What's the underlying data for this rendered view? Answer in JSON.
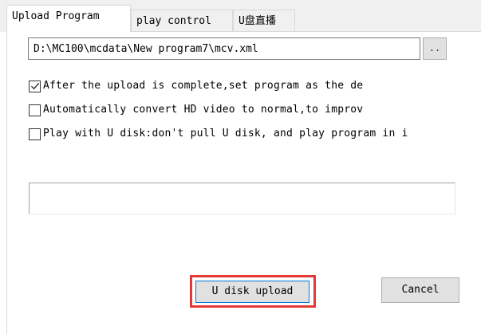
{
  "tabs": [
    {
      "label": "Upload Program",
      "active": true
    },
    {
      "label": "play control",
      "active": false
    },
    {
      "label": "U盘直播",
      "active": false
    }
  ],
  "upload": {
    "path_value": "D:\\MC100\\mcdata\\New program7\\mcv.xml",
    "browse_label": "..",
    "options": [
      {
        "label": "After the upload is complete,set program as the de",
        "checked": true
      },
      {
        "label": "Automatically convert HD video to normal,to improv",
        "checked": false
      },
      {
        "label": "Play with U disk:don't pull U disk, and play program in i",
        "checked": false
      }
    ],
    "progress": 0,
    "upload_button_label": "U disk upload",
    "cancel_button_label": "Cancel"
  },
  "colors": {
    "highlight_border": "#e53935",
    "focus_border": "#0078d7",
    "button_face": "#e1e1e1"
  }
}
